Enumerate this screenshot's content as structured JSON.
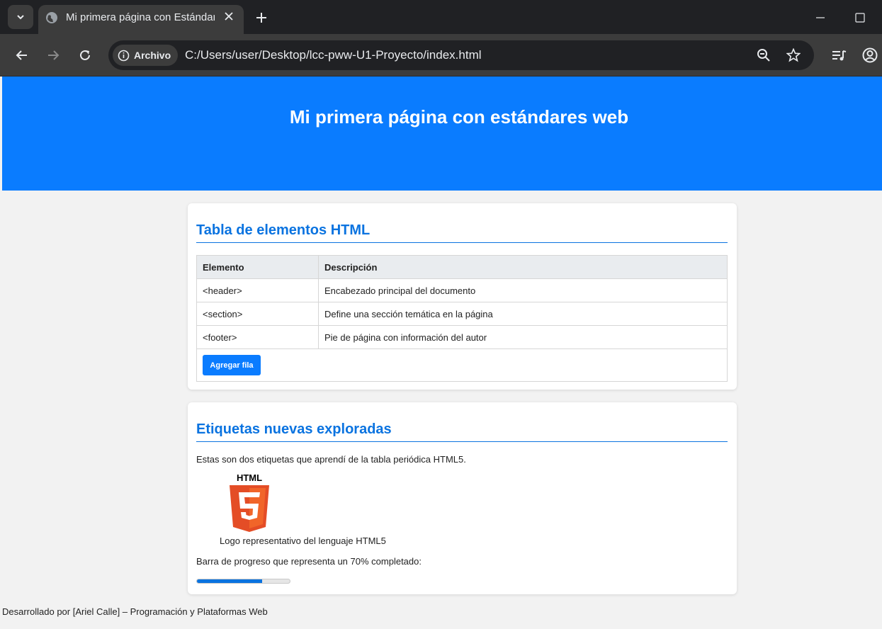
{
  "browser": {
    "tab_title": "Mi primera página con Estándares web",
    "address_chip": "Archivo",
    "url": "C:/Users/user/Desktop/lcc-pww-U1-Proyecto/index.html",
    "icons": [
      "tab-search-icon",
      "globe-icon",
      "close-icon",
      "plus-icon",
      "minimize-icon",
      "maximize-icon",
      "back-icon",
      "forward-icon",
      "reload-icon",
      "info-icon",
      "zoom-icon",
      "star-icon",
      "media-icon",
      "profile-icon"
    ]
  },
  "page": {
    "header_title": "Mi primera página con estándares web",
    "table_section": {
      "heading": "Tabla de elementos HTML",
      "columns": [
        "Elemento",
        "Descripción"
      ],
      "rows": [
        [
          "<header>",
          "Encabezado principal del documento"
        ],
        [
          "<section>",
          "Define una sección temática en la página"
        ],
        [
          "<footer>",
          "Pie de página con información del autor"
        ]
      ],
      "add_button": "Agregar fila"
    },
    "tags_section": {
      "heading": "Etiquetas nuevas exploradas",
      "intro": "Estas son dos etiquetas que aprendí de la tabla periódica HTML5.",
      "logo_text": "HTML",
      "logo_caption": "Logo representativo del lenguaje HTML5",
      "progress_label": "Barra de progreso que representa un 70% completado:",
      "progress_value": 0.7
    },
    "footer": "Desarrollado por [Ariel Calle] – Programación y Plataformas Web"
  },
  "colors": {
    "header_bg": "#0a7cff",
    "heading": "#0a73e0",
    "html5_orange": "#e44d26"
  }
}
